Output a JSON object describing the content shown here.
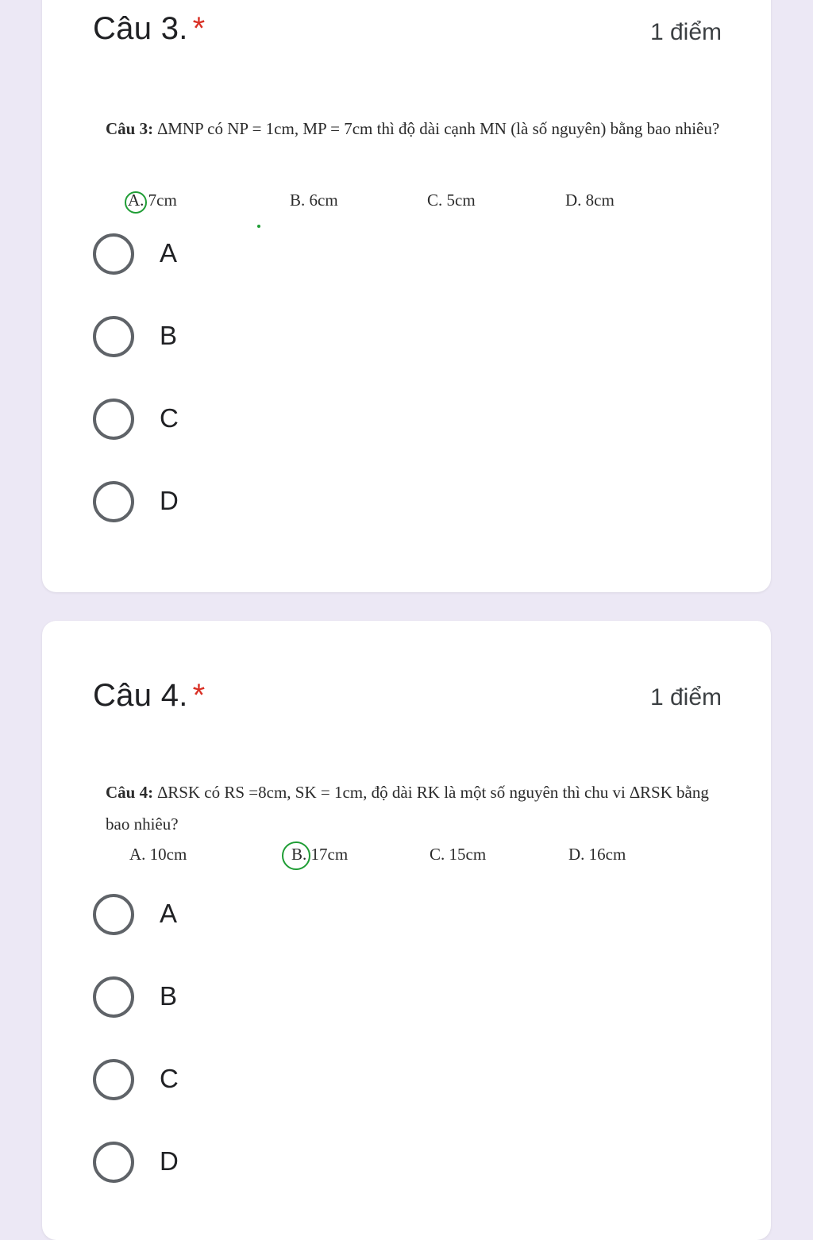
{
  "q3": {
    "title": "Câu 3.",
    "required_mark": "*",
    "points": "1 điểm",
    "problem_label": "Câu 3:",
    "problem_text": " ∆MNP có NP = 1cm, MP = 7cm thì độ dài cạnh MN (là số nguyên) bằng bao nhiêu?",
    "options": [
      "A. 7cm",
      "B. 6cm",
      "C. 5cm",
      "D. 8cm"
    ],
    "circled_option": "A",
    "choices": [
      "A",
      "B",
      "C",
      "D"
    ]
  },
  "q4": {
    "title": "Câu 4.",
    "required_mark": "*",
    "points": "1 điểm",
    "problem_label": "Câu 4:",
    "problem_text": " ∆RSK có RS =8cm, SK = 1cm, độ dài RK là một số nguyên thì chu vi ∆RSK bằng bao nhiêu?",
    "options": [
      "A. 10cm",
      "B. 17cm",
      "C. 15cm",
      "D. 16cm"
    ],
    "circled_option": "B",
    "choices": [
      "A",
      "B",
      "C",
      "D"
    ]
  },
  "colors": {
    "background": "#ece8f5",
    "required": "#d93025",
    "circle_mark": "#1f9d35",
    "radio": "#5f6368"
  }
}
